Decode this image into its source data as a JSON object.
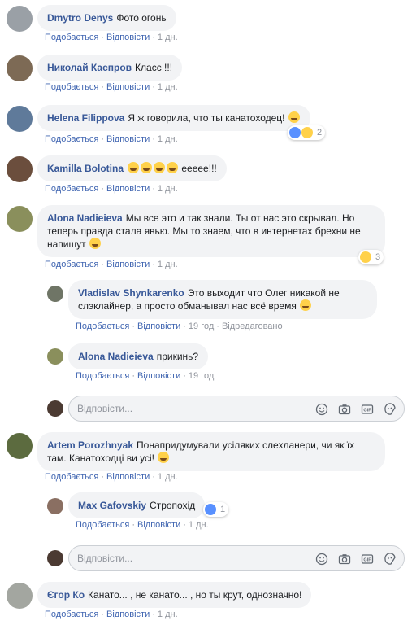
{
  "labels": {
    "like": "Подобається",
    "reply": "Відповісти",
    "edited": "Відредаговано",
    "reply_placeholder": "Відповісти..."
  },
  "comments": [
    {
      "author": "Dmytro Denys",
      "text": "Фото огонь",
      "time": "1 дн."
    },
    {
      "author": "Николай Каспров",
      "text": "Класс !!!",
      "time": "1 дн."
    },
    {
      "author": "Helena Filippova",
      "text": "Я ж говорила, что ты канатоходец!",
      "time": "1 дн.",
      "reactions": "2"
    },
    {
      "author": "Kamilla Bolotina",
      "text": "еееее!!!",
      "time": "1 дн."
    },
    {
      "author": "Alona Nadieieva",
      "text": "Мы все это и так знали. Ты от нас это скрывал. Но теперь правда стала явью. Мы то знаем, что в интернетах брехни не напишут",
      "time": "1 дн.",
      "reactions": "3"
    },
    {
      "author": "Vladislav Shynkarenko",
      "text": "Это выходит что Олег никакой не слэклайнер, а просто обманывал нас всё время",
      "time": "19 год"
    },
    {
      "author": "Alona Nadieieva",
      "text": "прикинь?",
      "time": "19 год"
    },
    {
      "author": "Artem Porozhnyak",
      "text": "Понапридумували усіляких слехланери, чи як їх там. Канатоходці ви усі!",
      "time": "1 дн."
    },
    {
      "author": "Max Gafovskiy",
      "text": "Стропохід",
      "time": "1 дн.",
      "reactions": "1"
    },
    {
      "author": "Єгор Ко",
      "text": "Канато... , не канато... , но ты крут, однозначно!",
      "time": "1 дн."
    }
  ],
  "colors": {
    "link": "#385898",
    "bubble": "#f2f3f5",
    "meta": "#90949c"
  }
}
